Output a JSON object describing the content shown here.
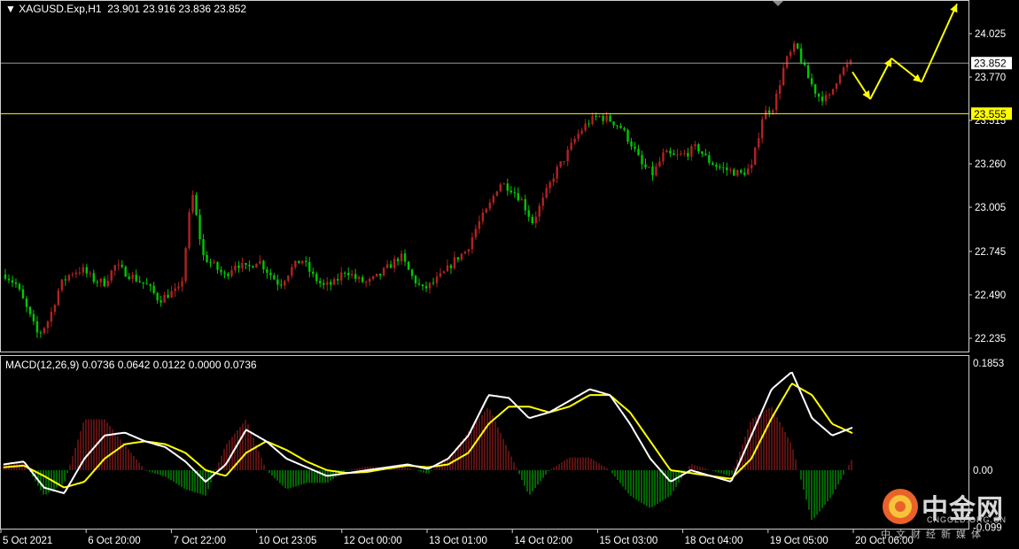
{
  "header": {
    "symbol": "XAGUSD.Exp,H1",
    "ohlc": "23.901 23.916 23.836 23.852"
  },
  "macd_header": "MACD(12,26,9) 0.0736 0.0642 0.0122 0.0000 0.0736",
  "colors": {
    "bull": "#b22222",
    "bear": "#00c800",
    "macd_line": "#ffffff",
    "signal_line": "#ffff00",
    "hline_current": "#9a9a9a",
    "hline_level": "#ffff00",
    "arrow": "#ffff00"
  },
  "price_axis": {
    "ticks": [
      24.025,
      23.77,
      23.515,
      23.26,
      23.005,
      22.745,
      22.49,
      22.235
    ],
    "tick_labels": [
      "24.025",
      "23.770",
      "23.515",
      "23.260",
      "23.005",
      "22.745",
      "22.490",
      "22.235"
    ],
    "current_label": "23.852",
    "level_label": "23.555"
  },
  "macd_axis": {
    "tick_labels": [
      "0.1853",
      "0.00",
      "-0.099"
    ]
  },
  "time_axis": {
    "labels": [
      "5 Oct 2021",
      "6 Oct 20:00",
      "7 Oct 22:00",
      "10 Oct 23:05",
      "12 Oct 00:00",
      "13 Oct 01:00",
      "14 Oct 02:00",
      "15 Oct 03:00",
      "18 Oct 04:00",
      "19 Oct 05:00",
      "20 Oct 06:00"
    ]
  },
  "chart_data": {
    "type": "candlestick",
    "symbol": "XAGUSD.Exp",
    "timeframe": "H1",
    "price_range": [
      22.16,
      24.2
    ],
    "last_close": 23.852,
    "horizontal_lines": [
      23.852,
      23.555
    ],
    "close_path": [
      22.61,
      22.55,
      22.4,
      22.25,
      22.35,
      22.55,
      22.62,
      22.64,
      22.58,
      22.56,
      22.66,
      22.62,
      22.58,
      22.54,
      22.46,
      22.5,
      22.52,
      23.1,
      22.72,
      22.66,
      22.6,
      22.68,
      22.64,
      22.7,
      22.62,
      22.55,
      22.64,
      22.7,
      22.6,
      22.54,
      22.56,
      22.64,
      22.58,
      22.56,
      22.6,
      22.66,
      22.72,
      22.6,
      22.52,
      22.56,
      22.62,
      22.7,
      22.75,
      22.9,
      23.0,
      23.15,
      23.12,
      23.05,
      22.92,
      23.05,
      23.2,
      23.3,
      23.42,
      23.5,
      23.54,
      23.52,
      23.48,
      23.38,
      23.25,
      23.2,
      23.32,
      23.3,
      23.32,
      23.36,
      23.28,
      23.24,
      23.22,
      23.2,
      23.24,
      23.55,
      23.6,
      23.85,
      23.96,
      23.78,
      23.66,
      23.64,
      23.8,
      23.852
    ],
    "macd_range": [
      -0.099,
      0.1853
    ],
    "macd_line": [
      0.01,
      0.015,
      -0.03,
      -0.04,
      0.02,
      0.06,
      0.065,
      0.05,
      0.04,
      0.015,
      -0.02,
      0.01,
      0.07,
      0.05,
      0.02,
      0.005,
      -0.01,
      -0.005,
      0.0,
      0.005,
      0.01,
      0.002,
      0.02,
      0.06,
      0.13,
      0.125,
      0.09,
      0.1,
      0.12,
      0.14,
      0.13,
      0.08,
      0.02,
      -0.02,
      0.0,
      -0.01,
      -0.02,
      0.06,
      0.14,
      0.17,
      0.09,
      0.06,
      0.0736
    ],
    "signal_line": [
      0.005,
      0.008,
      -0.01,
      -0.03,
      -0.02,
      0.02,
      0.045,
      0.05,
      0.045,
      0.03,
      0.0,
      -0.01,
      0.03,
      0.05,
      0.035,
      0.015,
      0.0,
      -0.005,
      -0.003,
      0.003,
      0.008,
      0.005,
      0.01,
      0.03,
      0.08,
      0.11,
      0.11,
      0.1,
      0.11,
      0.13,
      0.13,
      0.1,
      0.05,
      0.0,
      -0.005,
      -0.01,
      -0.015,
      0.02,
      0.09,
      0.15,
      0.13,
      0.08,
      0.0642
    ],
    "forecast_arrows": [
      {
        "from": 23.8,
        "to": 23.64
      },
      {
        "from": 23.64,
        "to": 23.88
      },
      {
        "from": 23.88,
        "to": 23.74
      },
      {
        "from": 23.74,
        "to": 24.2
      }
    ]
  }
}
